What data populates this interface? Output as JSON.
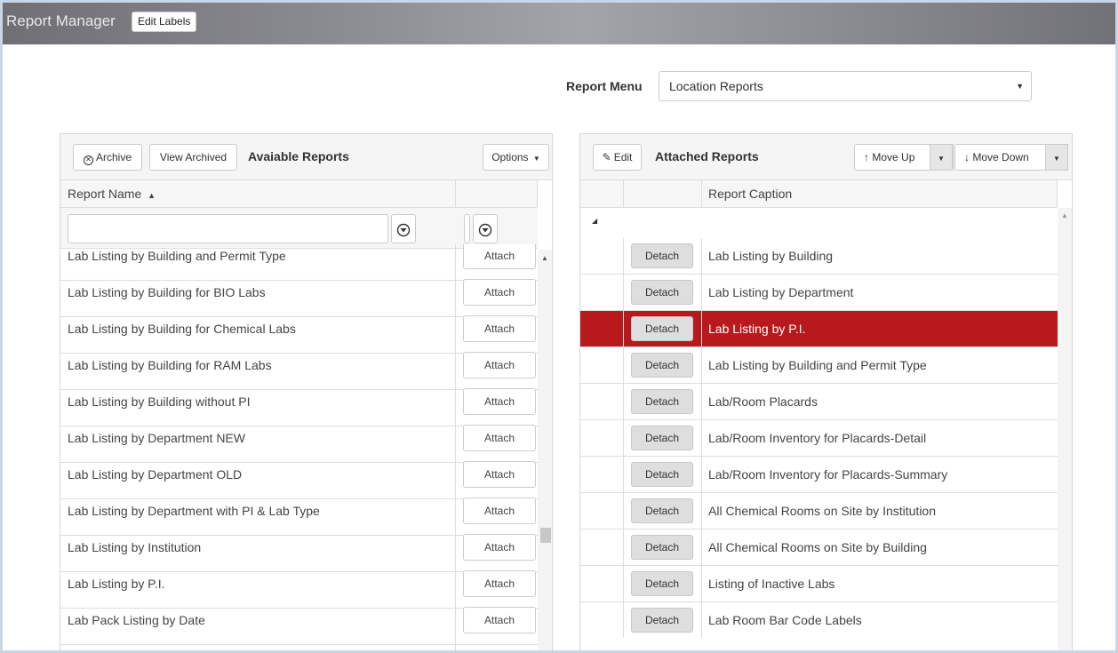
{
  "header": {
    "title": "Report Manager",
    "edit_labels": "Edit Labels"
  },
  "report_menu": {
    "label": "Report Menu",
    "selected": "Location Reports"
  },
  "available": {
    "archive_label": "Archive",
    "view_archived_label": "View Archived",
    "title": "Avaiable Reports",
    "options_label": "Options",
    "col_report_name": "Report Name",
    "filter_value": "",
    "attach_label": "Attach",
    "rows": [
      "Lab Listing by Building and Permit Type",
      "Lab Listing by Building for BIO Labs",
      "Lab Listing by Building for Chemical Labs",
      "Lab Listing by Building for RAM Labs",
      "Lab Listing by Building without PI",
      "Lab Listing by Department NEW",
      "Lab Listing by Department OLD",
      "Lab Listing by Department with PI & Lab Type",
      "Lab Listing by Institution",
      "Lab Listing by P.I.",
      "Lab Pack Listing by Date"
    ]
  },
  "attached": {
    "edit_label": "Edit",
    "title": "Attached Reports",
    "move_up_label": "Move Up",
    "move_down_label": "Move Down",
    "col_report_caption": "Report Caption",
    "detach_label": "Detach",
    "selected_index": 2,
    "rows": [
      "Lab Listing by Building",
      "Lab Listing by Department",
      "Lab Listing by P.I.",
      "Lab Listing by Building and Permit Type",
      "Lab/Room Placards",
      "Lab/Room Inventory for Placards-Detail",
      "Lab/Room Inventory for Placards-Summary",
      "All Chemical Rooms on Site by Institution",
      "All Chemical Rooms on Site by Building",
      "Listing of Inactive Labs",
      "Lab Room Bar Code Labels"
    ]
  },
  "colors": {
    "selected_row": "#b8191d"
  }
}
